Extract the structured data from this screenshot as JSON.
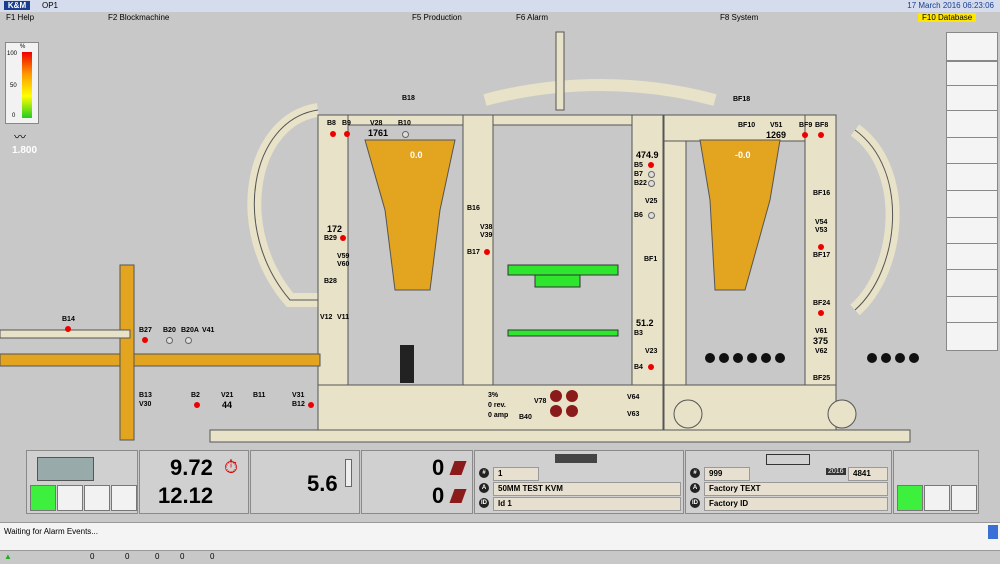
{
  "header": {
    "logo": "K&M",
    "station": "OP1",
    "datetime": "17 March 2016 06:23:06"
  },
  "menu": {
    "help": "F1 Help",
    "blockmachine": "F2 Blockmachine",
    "production": "F5 Production",
    "alarm": "F6 Alarm",
    "system": "F8 System",
    "database": "F10 Database"
  },
  "gauge": {
    "percent_label": "%",
    "tick_100": "100",
    "tick_50": "50",
    "tick_0": "0",
    "value": "1.800",
    "level": 0.35
  },
  "labels": {
    "b18": "B18",
    "b8": "B8",
    "b9": "B9",
    "v28": "V28",
    "v28_val": "1761",
    "b10": "B10",
    "hopper_left": "0.0",
    "v474": "474.9",
    "b5": "B5",
    "b7": "B7",
    "b22": "B22",
    "v25": "V25",
    "b6": "B6",
    "b16": "B16",
    "v38": "V38",
    "v39": "V39",
    "b17": "B17",
    "b29_val": "172",
    "b29": "B29",
    "v59": "V59",
    "v60": "V60",
    "b28": "B28",
    "bf1": "BF1",
    "v512": "51.2",
    "b3": "B3",
    "v23": "V23",
    "b4": "B4",
    "bf18": "BF18",
    "bf10": "BF10",
    "v51": "V51",
    "v51_val": "1269",
    "bf9": "BF9",
    "bf8": "BF8",
    "hopper_right": "-0.0",
    "bf16": "BF16",
    "v54": "V54",
    "v53": "V53",
    "bf17": "BF17",
    "bf24": "BF24",
    "v61": "V61",
    "v61_val": "375",
    "v62": "V62",
    "bf25": "BF25",
    "b14": "B14",
    "b27": "B27",
    "b20": "B20",
    "b20a": "B20A",
    "v41": "V41",
    "v12": "V12",
    "v11": "V11",
    "b13": "B13",
    "v30": "V30",
    "b2": "B2",
    "v21": "V21",
    "v21_val": "44",
    "b11": "B11",
    "v31": "V31",
    "b12": "B12",
    "pct": "3",
    "pct_unit": "%",
    "rev": "0",
    "rev_unit": "rev.",
    "amp": "0",
    "amp_unit": "amp",
    "b40": "B40",
    "v78": "V78",
    "v64": "V64",
    "v63": "V63"
  },
  "panels": {
    "time_top": "9.72",
    "time_bottom": "12.12",
    "cycle_value": "5.6",
    "count_top": "0",
    "count_bottom": "0",
    "recipe": {
      "number": "1",
      "name": "50MM TEST KVM",
      "id": "Id 1"
    },
    "factory": {
      "number": "999",
      "year": "2016",
      "count": "4841",
      "text": "Factory TEXT",
      "id": "Factory ID"
    },
    "hash": "#",
    "a_icon": "A",
    "id_icon": "ID"
  },
  "status": {
    "message": "Waiting for Alarm Events..."
  },
  "footer": {
    "c1": "0",
    "c2": "0",
    "c3": "0",
    "c4": "0",
    "c5": "0"
  },
  "colors": {
    "frame": "#e8e2c8",
    "ochre": "#e3a520",
    "green": "#2ee62e",
    "alarm": "#e00000"
  }
}
